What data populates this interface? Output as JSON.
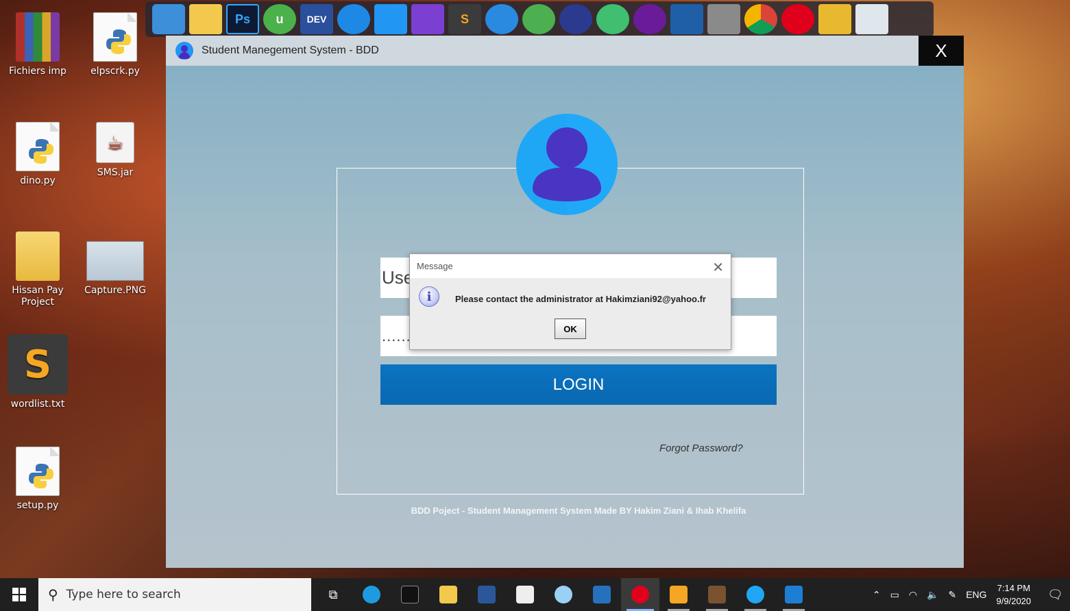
{
  "desktop": {
    "icons": [
      {
        "label": "Fichiers imp"
      },
      {
        "label": "elpscrk.py"
      },
      {
        "label": "dino.py"
      },
      {
        "label": "SMS.jar"
      },
      {
        "label": "Hissan Pay Project"
      },
      {
        "label": "Capture.PNG"
      },
      {
        "label": "wordlist.txt"
      },
      {
        "label": "setup.py"
      }
    ]
  },
  "dock": {
    "items": [
      {
        "icon": "computer-icon",
        "text": ""
      },
      {
        "icon": "downloads-folder-icon",
        "text": ""
      },
      {
        "icon": "photoshop-icon",
        "text": "Ps"
      },
      {
        "icon": "utorrent-icon",
        "text": "u"
      },
      {
        "icon": "devcpp-icon",
        "text": "DEV"
      },
      {
        "icon": "app-icon",
        "text": ""
      },
      {
        "icon": "vscode-icon",
        "text": ""
      },
      {
        "icon": "visual-studio-icon",
        "text": ""
      },
      {
        "icon": "sublime-icon",
        "text": "S"
      },
      {
        "icon": "lightning-icon",
        "text": ""
      },
      {
        "icon": "android-studio-icon",
        "text": ""
      },
      {
        "icon": "app-icon",
        "text": ""
      },
      {
        "icon": "atom-icon",
        "text": ""
      },
      {
        "icon": "app-icon",
        "text": ""
      },
      {
        "icon": "virtualbox-icon",
        "text": ""
      },
      {
        "icon": "tools-icon",
        "text": ""
      },
      {
        "icon": "chrome-icon",
        "text": ""
      },
      {
        "icon": "opera-icon",
        "text": ""
      },
      {
        "icon": "tools-icon",
        "text": ""
      },
      {
        "icon": "recycle-bin-icon",
        "text": ""
      }
    ]
  },
  "app": {
    "title": "Student Manegement System - BDD",
    "close_label": "X",
    "username_visible_text": "Use",
    "password_mask": ".......",
    "login_label": "LOGIN",
    "forgot_label": "Forgot Password?",
    "footer": "BDD Poject - Student Management System Made BY Hakim Ziani & Ihab Khelifa"
  },
  "dialog": {
    "title": "Message",
    "close_glyph": "✕",
    "info_glyph": "i",
    "message": "Please contact the administrator at Hakimziani92@yahoo.fr",
    "ok_label": "OK"
  },
  "taskbar": {
    "search_placeholder": "Type here to search",
    "tray": {
      "language": "ENG",
      "time": "7:14 PM",
      "date": "9/9/2020"
    }
  },
  "colors": {
    "login_button": "#0a6fba",
    "avatar_circle": "#1fa7f5",
    "avatar_person": "#4a34c2"
  }
}
